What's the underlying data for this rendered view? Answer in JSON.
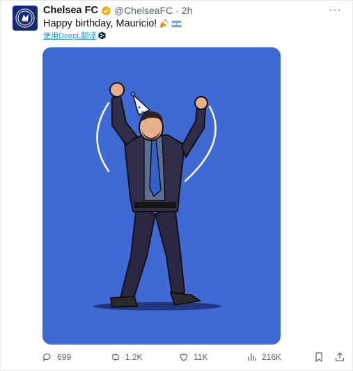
{
  "tweet": {
    "display_name": "Chelsea FC",
    "handle": "@ChelseaFC",
    "separator": "·",
    "time": "2h",
    "text": "Happy birthday, Mauricio!",
    "translate_label": "使用DeepL翻译",
    "more_label": "···"
  },
  "actions": {
    "replies": "699",
    "reposts": "1.2K",
    "likes": "11K",
    "views": "216K"
  },
  "colors": {
    "brand": "#0a2a84",
    "media_background": "#3f6ad6",
    "verified_badge": "#e7b416",
    "link": "#1d9bf0"
  },
  "icons": [
    "chelsea-crest",
    "verified-badge",
    "party-popper-emoji",
    "argentina-flag-emoji",
    "deepl-icon",
    "more-icon",
    "reply-icon",
    "repost-icon",
    "like-icon",
    "views-icon",
    "bookmark-icon",
    "share-icon"
  ]
}
